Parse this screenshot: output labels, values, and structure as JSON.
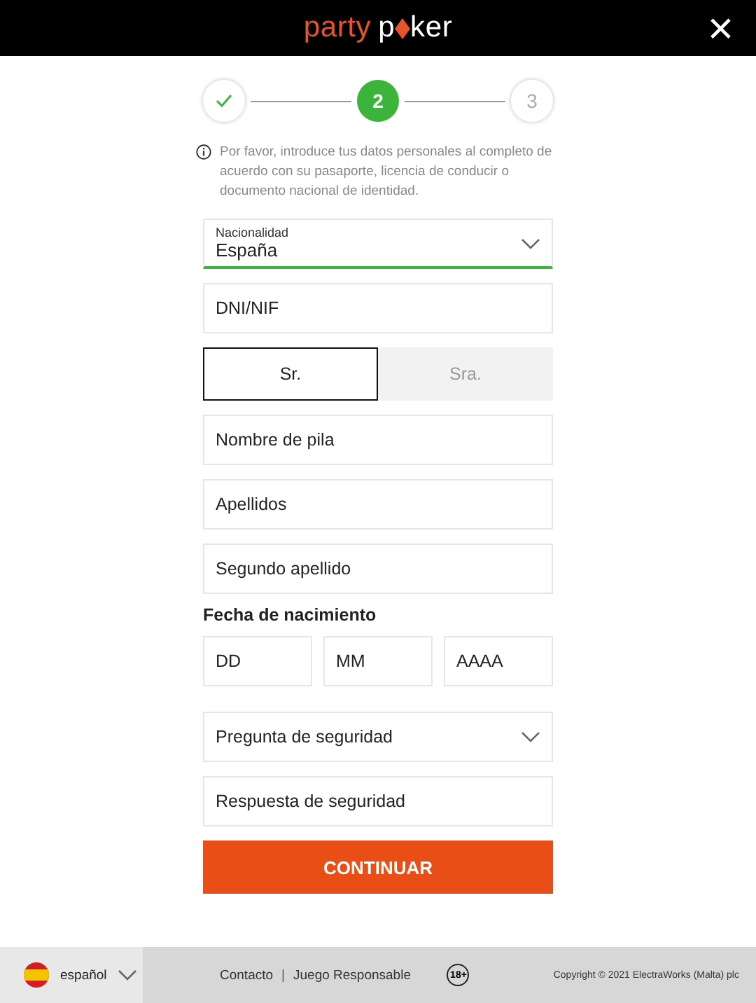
{
  "header": {
    "logo": [
      "party",
      "p",
      "ker"
    ],
    "close": "×"
  },
  "steps": [
    {
      "completed": true,
      "selected": false
    },
    {
      "label": "2",
      "completed": false,
      "selected": true
    },
    {
      "label": "3",
      "completed": false,
      "selected": false
    }
  ],
  "info": "Por favor, introduce tus datos personales al completo de acuerdo con su pasaporte, licencia de conducir o documento nacional de identidad.",
  "nationality": {
    "label": "Nacionalidad",
    "value": "España"
  },
  "id_field": {
    "placeholder": "DNI/NIF"
  },
  "titles": [
    {
      "label": "Sr.",
      "selected": true
    },
    {
      "label": "Sra.",
      "selected": false
    }
  ],
  "name_fields": [
    {
      "placeholder": "Nombre de pila"
    },
    {
      "placeholder": "Apellidos"
    },
    {
      "placeholder": "Segundo apellido"
    }
  ],
  "birth": {
    "label": "Fecha de nacimiento",
    "fields": [
      {
        "placeholder": "DD"
      },
      {
        "placeholder": "MM"
      },
      {
        "placeholder": "AAAA"
      }
    ]
  },
  "security_question": {
    "placeholder": "Pregunta de seguridad"
  },
  "security_answer": {
    "placeholder": "Respuesta de seguridad"
  },
  "submit": "CONTINUAR",
  "footer": {
    "language": "español",
    "links": [
      "Contacto",
      "Juego Responsable"
    ],
    "separator": "|",
    "age": "18+",
    "copyright": "Copyright © 2021 ElectraWorks (Malta) plc"
  }
}
